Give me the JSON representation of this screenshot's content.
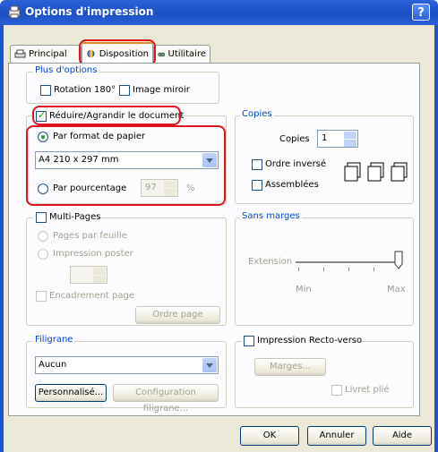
{
  "window": {
    "title": "Options d'impression",
    "help": "?"
  },
  "tabs": [
    {
      "label": "Principal"
    },
    {
      "label": "Disposition"
    },
    {
      "label": "Utilitaire"
    }
  ],
  "plus_options": {
    "title": "Plus d'options",
    "rotation": "Rotation 180°",
    "mirror": "Image miroir"
  },
  "reduce": {
    "checkbox": "Réduire/Agrandir le document",
    "by_paper": "Par format de papier",
    "paper_value": "A4 210 x 297 mm",
    "by_percent": "Par pourcentage",
    "percent_value": "97",
    "percent_unit": "%"
  },
  "copies": {
    "title": "Copies",
    "label": "Copies",
    "value": "1",
    "reverse": "Ordre inversé",
    "collate": "Assemblées"
  },
  "multipage": {
    "checkbox": "Multi-Pages",
    "per_sheet": "Pages par feuille",
    "poster": "Impression poster",
    "border": "Encadrement page",
    "order_button": "Ordre page"
  },
  "borderless": {
    "title": "Sans marges",
    "extension": "Extension",
    "min": "Min",
    "max": "Max"
  },
  "watermark": {
    "title": "Filigrane",
    "value": "Aucun",
    "custom_button": "Personnalisé...",
    "config_button": "Configuration filigrane..."
  },
  "duplex": {
    "checkbox": "Impression Recto-verso",
    "margins_button": "Marges...",
    "booklet": "Livret plié"
  },
  "footer": {
    "ok": "OK",
    "cancel": "Annuler",
    "help": "Aide"
  }
}
